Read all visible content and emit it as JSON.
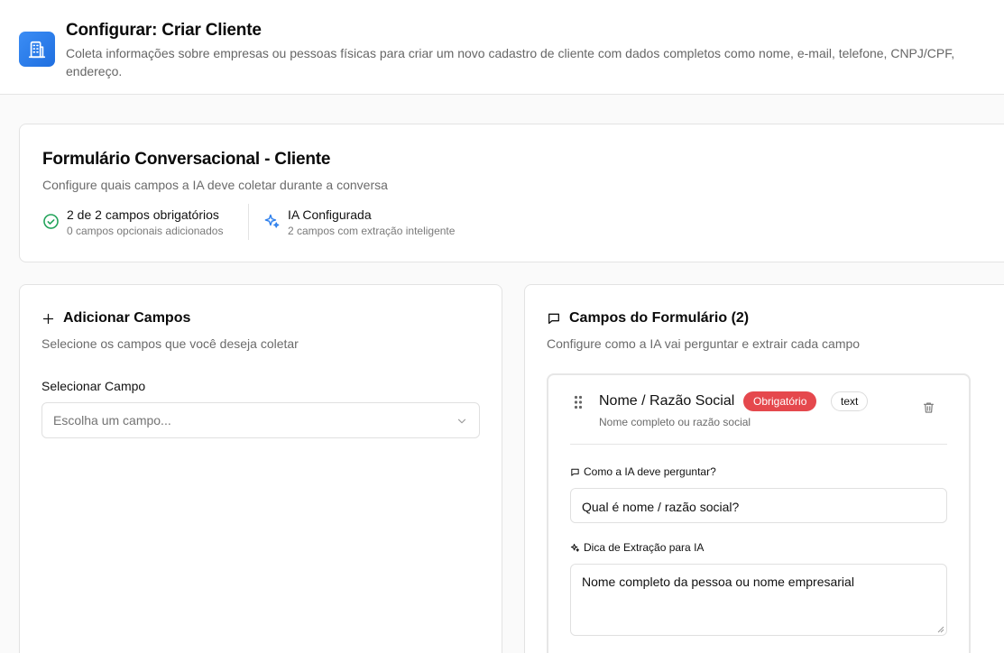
{
  "header": {
    "title": "Configurar: Criar Cliente",
    "description": "Coleta informações sobre empresas ou pessoas físicas para criar um novo cadastro de cliente com dados completos como nome, e-mail, telefone, CNPJ/CPF, endereço.",
    "icon": "building-icon"
  },
  "summary": {
    "title": "Formulário Conversacional - Cliente",
    "subtitle": "Configure quais campos a IA deve coletar durante a conversa",
    "required_stat": {
      "main": "2 de 2 campos obrigatórios",
      "sub": "0 campos opcionais adicionados",
      "icon": "check-circle-icon"
    },
    "ai_stat": {
      "main": "IA Configurada",
      "sub": "2 campos com extração inteligente",
      "icon": "sparkles-icon"
    }
  },
  "add_fields": {
    "title": "Adicionar Campos",
    "subtitle": "Selecione os campos que você deseja coletar",
    "select_label": "Selecionar Campo",
    "select_placeholder": "Escolha um campo..."
  },
  "form_fields": {
    "title": "Campos do Formulário (2)",
    "subtitle": "Configure como a IA vai perguntar e extrair cada campo",
    "fields": [
      {
        "name": "Nome / Razão Social",
        "required_badge": "Obrigatório",
        "type_badge": "text",
        "description": "Nome completo ou razão social",
        "question_label": "Como a IA deve perguntar?",
        "question_value": "Qual é nome / razão social?",
        "hint_label": "Dica de Extração para IA",
        "hint_value": "Nome completo da pessoa ou nome empresarial"
      }
    ]
  },
  "colors": {
    "accent_blue": "#2f80ed",
    "required_red": "#e5484d",
    "success_green": "#22a35a"
  }
}
